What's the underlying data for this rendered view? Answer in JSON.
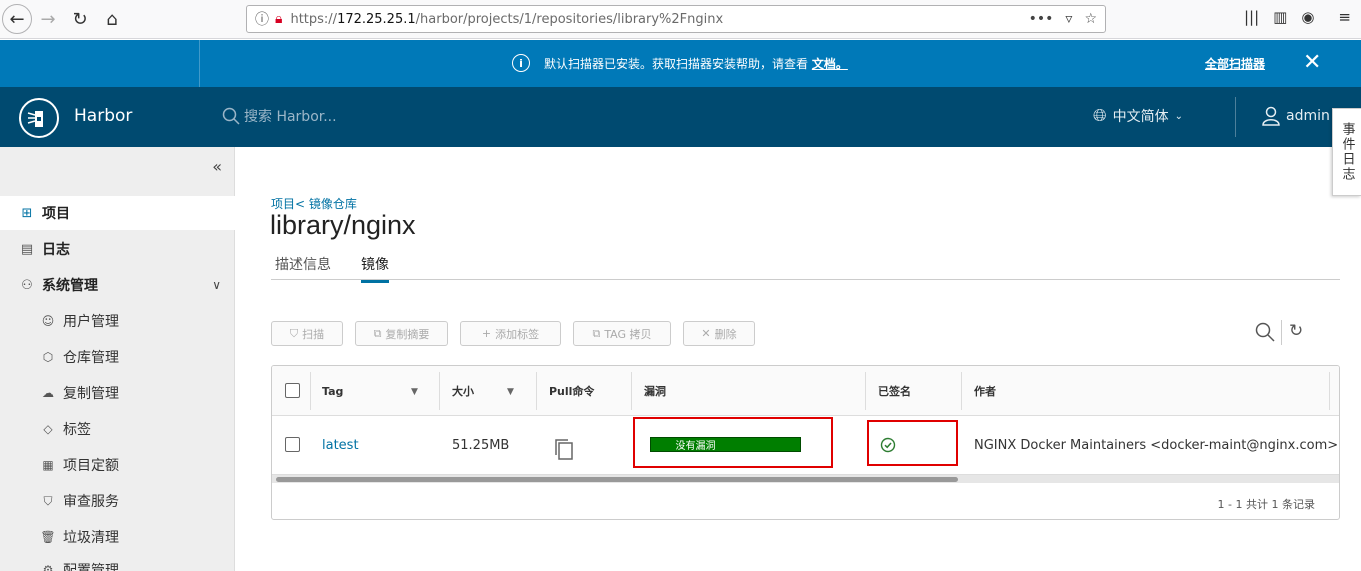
{
  "browser": {
    "url_prefix": "https://",
    "url_host": "172.25.25.1",
    "url_path": "/harbor/projects/1/repositories/library%2Fnginx"
  },
  "banner": {
    "message": "默认扫描器已安装。获取扫描器安装帮助，请查看",
    "doc_link": "文档。",
    "action": "全部扫描器"
  },
  "header": {
    "brand": "Harbor",
    "search_placeholder": "搜索 Harbor...",
    "language": "中文简体",
    "user": "admin"
  },
  "event_log": "事件日志",
  "sidebar": {
    "items": [
      {
        "label": "项目",
        "icon": "projects-icon"
      },
      {
        "label": "日志",
        "icon": "logs-icon"
      },
      {
        "label": "系统管理",
        "icon": "admin-icon"
      }
    ],
    "sub_items": [
      {
        "label": "用户管理",
        "icon": "users-icon"
      },
      {
        "label": "仓库管理",
        "icon": "registry-icon"
      },
      {
        "label": "复制管理",
        "icon": "replication-icon"
      },
      {
        "label": "标签",
        "icon": "tag-icon"
      },
      {
        "label": "项目定额",
        "icon": "quota-icon"
      },
      {
        "label": "审查服务",
        "icon": "shield-icon"
      },
      {
        "label": "垃圾清理",
        "icon": "trash-icon"
      },
      {
        "label": "配置管理",
        "icon": "config-icon"
      }
    ]
  },
  "page": {
    "breadcrumb": "项目< 镜像仓库",
    "title": "library/nginx",
    "tabs": [
      "描述信息",
      "镜像"
    ]
  },
  "toolbar": {
    "scan": "扫描",
    "copy_digest": "复制摘要",
    "add_label": "添加标签",
    "tag_copy": "TAG 拷贝",
    "delete": "删除"
  },
  "grid": {
    "columns": [
      "Tag",
      "大小",
      "Pull命令",
      "漏洞",
      "已签名",
      "作者"
    ],
    "rows": [
      {
        "tag": "latest",
        "size": "51.25MB",
        "vulnerability": "没有漏洞",
        "author": "NGINX Docker Maintainers <docker-maint@nginx.com>"
      }
    ],
    "footer": "1 - 1 共计 1 条记录"
  },
  "colors": {
    "banner": "#0079b8",
    "header": "#004a70",
    "link": "#0072a3",
    "vuln_ok": "#007e00",
    "highlight": "#e00000"
  }
}
